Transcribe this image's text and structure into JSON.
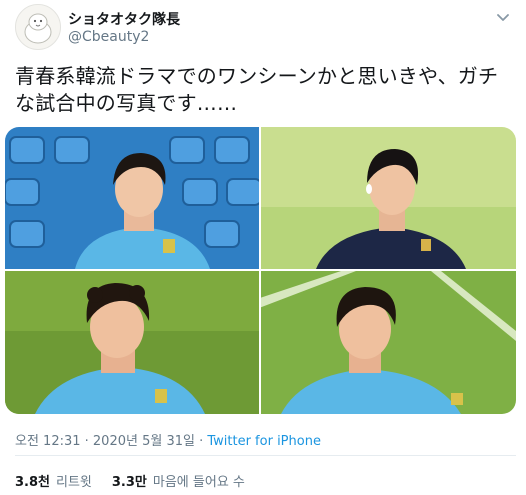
{
  "author": {
    "display_name": "ショタオタク隊長",
    "handle": "@Cbeauty2"
  },
  "tweet": {
    "text": "青春系韓流ドラマでのワンシーンかと思いきや、ガチな試合中の写真です……"
  },
  "media": {
    "photos": [
      {
        "icon": "photo-player-blue-seats"
      },
      {
        "icon": "photo-player-navy-jacket"
      },
      {
        "icon": "photo-player-curly-hair"
      },
      {
        "icon": "photo-player-sky-jersey"
      }
    ]
  },
  "meta": {
    "timestamp": "오전 12:31 · 2020년 5월 31일 · ",
    "source": "Twitter for iPhone"
  },
  "stats": {
    "retweets_count": "3.8천",
    "retweets_label": "리트윗",
    "likes_count": "3.3만",
    "likes_label": "마음에 들어요 수"
  },
  "colors": {
    "link": "#1b95e0",
    "secondary_text": "#657786",
    "jersey": "#5ab7e6"
  }
}
